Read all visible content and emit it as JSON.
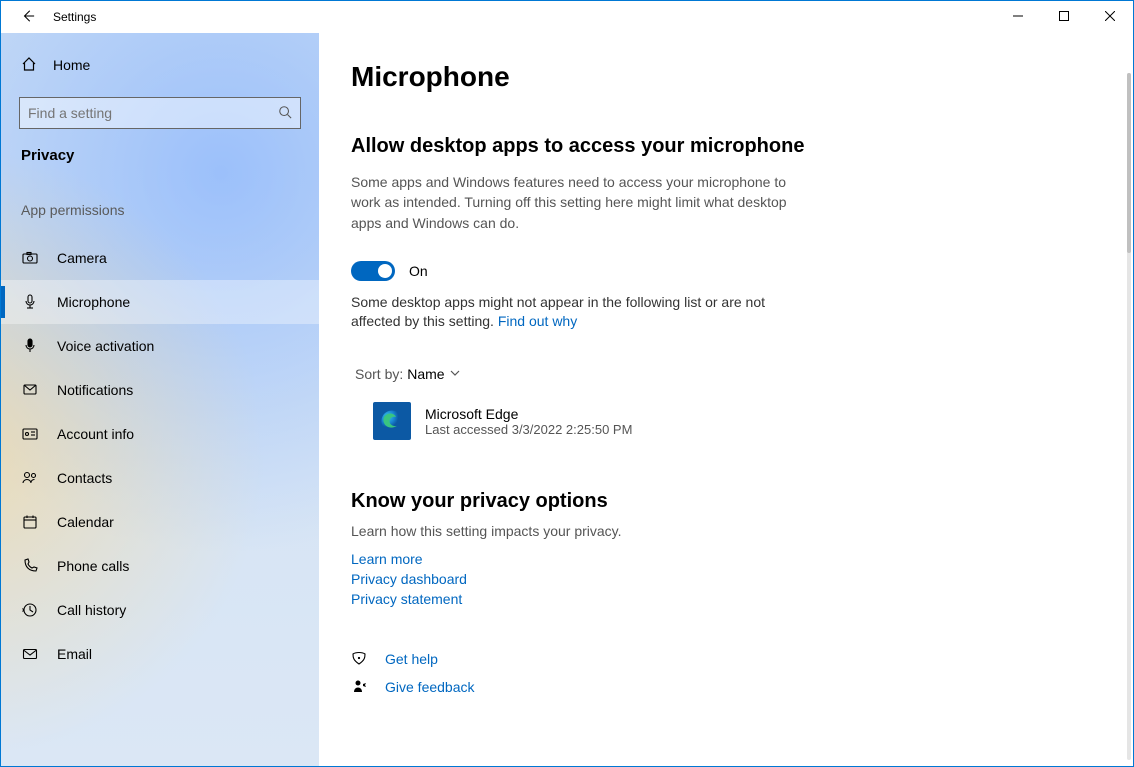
{
  "titlebar": {
    "title": "Settings"
  },
  "sidebar": {
    "home": "Home",
    "search_placeholder": "Find a setting",
    "section": "Privacy",
    "subsection": "App permissions",
    "items": [
      {
        "label": "Camera"
      },
      {
        "label": "Microphone"
      },
      {
        "label": "Voice activation"
      },
      {
        "label": "Notifications"
      },
      {
        "label": "Account info"
      },
      {
        "label": "Contacts"
      },
      {
        "label": "Calendar"
      },
      {
        "label": "Phone calls"
      },
      {
        "label": "Call history"
      },
      {
        "label": "Email"
      }
    ]
  },
  "page": {
    "title": "Microphone",
    "setting_title": "Allow desktop apps to access your microphone",
    "setting_desc": "Some apps and Windows features need to access your microphone to work as intended. Turning off this setting here might limit what desktop apps and Windows can do.",
    "toggle_state": "On",
    "note_text": "Some desktop apps might not appear in the following list or are not affected by this setting. ",
    "note_link": "Find out why",
    "sort_label": "Sort by:",
    "sort_value": "Name",
    "app": {
      "name": "Microsoft Edge",
      "sub": "Last accessed 3/3/2022 2:25:50 PM"
    },
    "privacy": {
      "title": "Know your privacy options",
      "desc": "Learn how this setting impacts your privacy.",
      "links": [
        "Learn more",
        "Privacy dashboard",
        "Privacy statement"
      ]
    },
    "footer": {
      "help": "Get help",
      "feedback": "Give feedback"
    }
  }
}
